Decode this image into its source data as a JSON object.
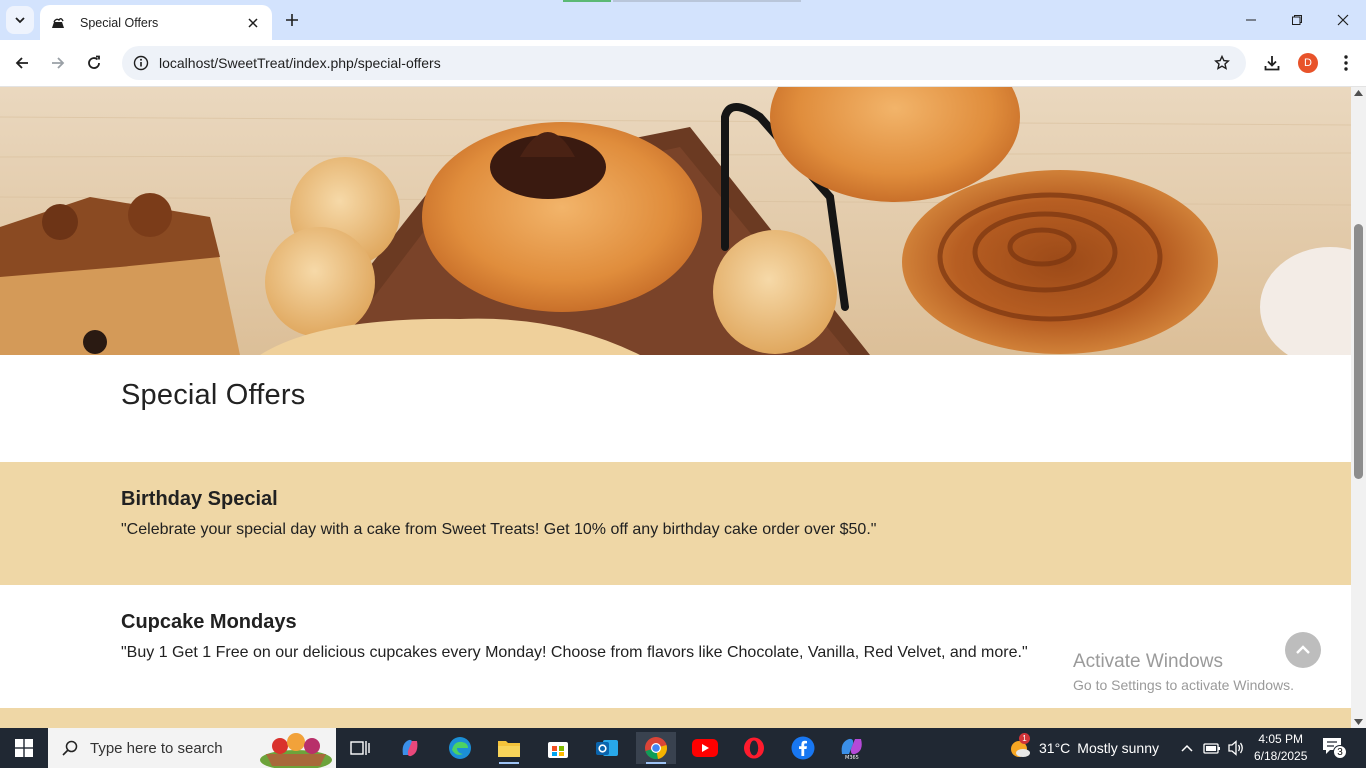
{
  "browser": {
    "tab_title": "Special Offers",
    "url": "localhost/SweetTreat/index.php/special-offers",
    "profile_initial": "D"
  },
  "page": {
    "title": "Special Offers",
    "offers": [
      {
        "title": "Birthday Special",
        "description": "\"Celebrate your special day with a cake from Sweet Treats! Get 10% off any birthday cake order over $50.\""
      },
      {
        "title": "Cupcake Mondays",
        "description": "\"Buy 1 Get 1 Free on our delicious cupcakes every Monday! Choose from flavors like Chocolate, Vanilla, Red Velvet, and more.\""
      }
    ]
  },
  "watermark": {
    "line1": "Activate Windows",
    "line2": "Go to Settings to activate Windows."
  },
  "taskbar": {
    "search_placeholder": "Type here to search",
    "weather_temp": "31°C",
    "weather_text": "Mostly sunny",
    "weather_badge": "1",
    "time": "4:05 PM",
    "date": "6/18/2025",
    "notification_count": "3"
  },
  "colors": {
    "offer_band": "#efd7a6",
    "tab_strip": "#d3e3fd",
    "taskbar": "#202833"
  }
}
